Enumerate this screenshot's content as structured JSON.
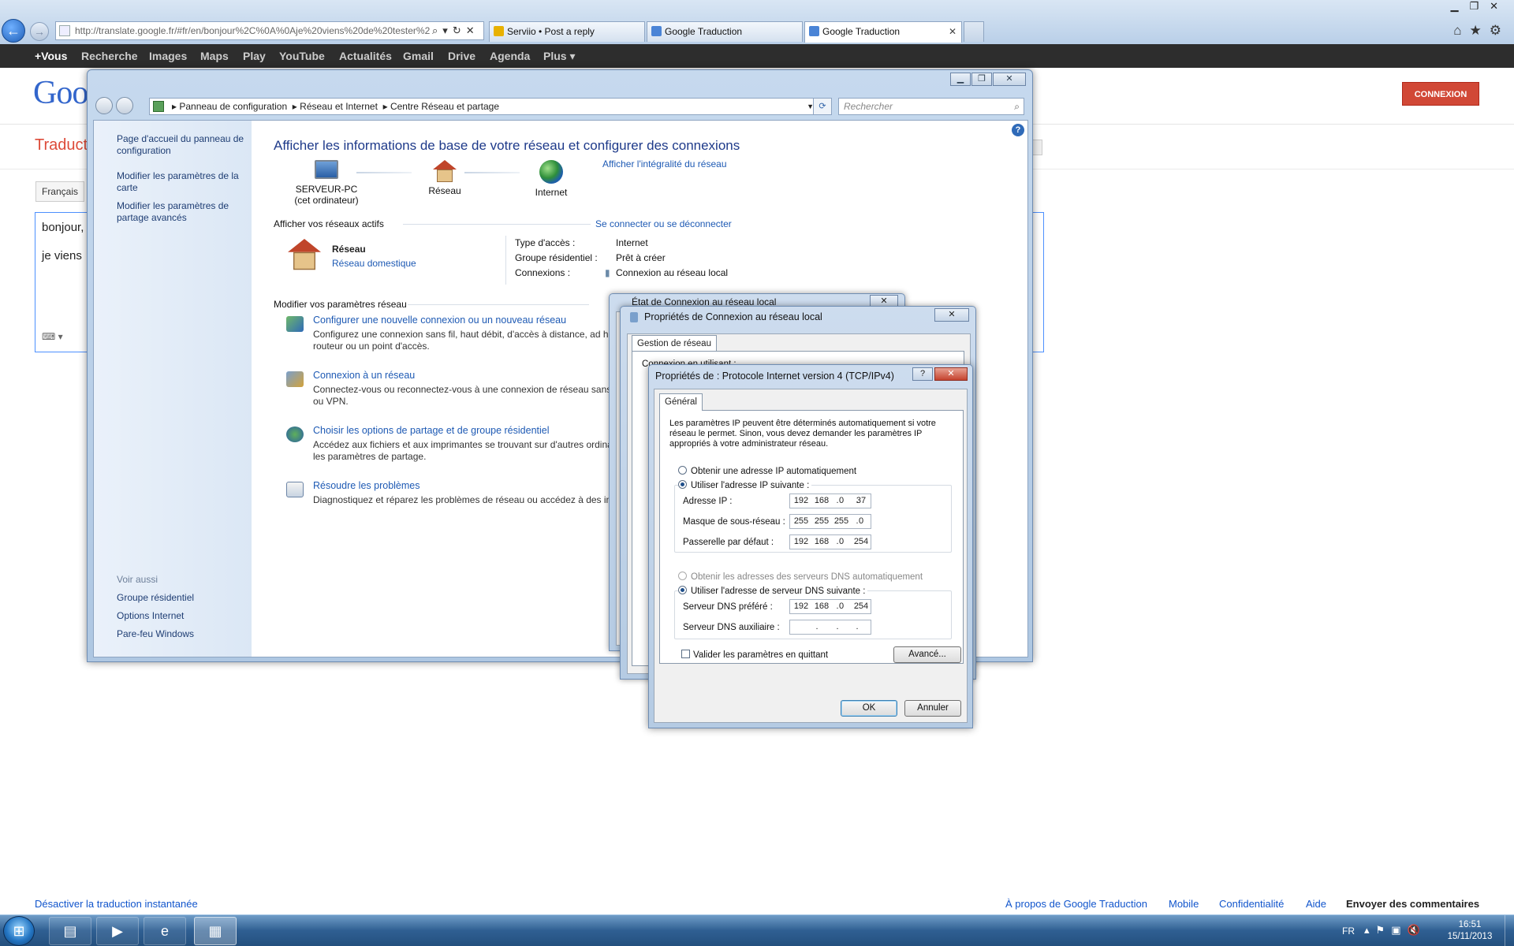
{
  "browser": {
    "address": "http://translate.google.fr/#fr/en/bonjour%2C%0A%0Aje%20viens%20de%20tester%2",
    "tabs": [
      {
        "label": "Serviio • Post a reply",
        "color": "#e8b100"
      },
      {
        "label": "Google Traduction",
        "color": "#4a84d6"
      },
      {
        "label": "Google Traduction",
        "color": "#4a84d6"
      }
    ]
  },
  "gbar": [
    "+Vous",
    "Recherche",
    "Images",
    "Maps",
    "Play",
    "YouTube",
    "Actualités",
    "Gmail",
    "Drive",
    "Agenda",
    "Plus ▾"
  ],
  "google": {
    "logo": "Goo",
    "signin": "CONNEXION",
    "section": "Traduct",
    "source_lang": "Français",
    "input_line1": "bonjour,",
    "input_line2": "je viens",
    "footer": {
      "disable": "Désactiver la traduction instantanée",
      "about": "À propos de Google Traduction",
      "mobile": "Mobile",
      "privacy": "Confidentialité",
      "help": "Aide",
      "feedback": "Envoyer des commentaires"
    }
  },
  "control_panel": {
    "breadcrumb": [
      "Panneau de configuration",
      "Réseau et Internet",
      "Centre Réseau et partage"
    ],
    "search_placeholder": "Rechercher",
    "sidebar": {
      "home": "Page d'accueil du panneau de configuration",
      "adapter": "Modifier les paramètres de la carte",
      "sharing": "Modifier les paramètres de partage avancés",
      "see_also": "Voir aussi",
      "homegroup": "Groupe résidentiel",
      "inet_options": "Options Internet",
      "firewall": "Pare-feu Windows"
    },
    "title": "Afficher les informations de base de votre réseau et configurer des connexions",
    "map": {
      "pc": "SERVEUR-PC",
      "pc_sub": "(cet ordinateur)",
      "network": "Réseau",
      "internet": "Internet",
      "full_map": "Afficher l'intégralité du réseau"
    },
    "active": {
      "heading": "Afficher vos réseaux actifs",
      "connect_link": "Se connecter ou se déconnecter",
      "name": "Réseau",
      "type": "Réseau domestique",
      "access_label": "Type d'accès :",
      "access_value": "Internet",
      "homegroup_label": "Groupe résidentiel :",
      "homegroup_value": "Prêt à créer",
      "connections_label": "Connexions :",
      "connections_value": "Connexion au réseau local"
    },
    "change": {
      "heading": "Modifier vos paramètres réseau",
      "tasks": [
        {
          "title": "Configurer une nouvelle connexion ou un nouveau réseau",
          "desc1": "Configurez une connexion sans fil, haut débit, d'accès à distance, ad ho",
          "desc2": "routeur ou un point d'accès."
        },
        {
          "title": "Connexion à un réseau",
          "desc1": "Connectez-vous ou reconnectez-vous à une connexion de réseau sans f",
          "desc2": "ou VPN."
        },
        {
          "title": "Choisir les options de partage et de groupe résidentiel",
          "desc1": "Accédez aux fichiers et aux imprimantes se trouvant sur d'autres ordinat",
          "desc2": "les paramètres de partage."
        },
        {
          "title": "Résoudre les problèmes",
          "desc1": "Diagnostiquez et réparez les problèmes de réseau ou accédez à des info",
          "desc2": ""
        }
      ]
    }
  },
  "etat_dialog": {
    "title": "État de Connexion au réseau local"
  },
  "prop_dialog": {
    "title": "Propriétés de Connexion au réseau local",
    "tab": "Gestion de réseau",
    "content": "Connexion en utilisant :"
  },
  "ipv4_dialog": {
    "title": "Propriétés de : Protocole Internet version 4 (TCP/IPv4)",
    "tab": "Général",
    "description": "Les paramètres IP peuvent être déterminés automatiquement si votre réseau le permet. Sinon, vous devez demander les paramètres IP appropriés à votre administrateur réseau.",
    "auto_ip": "Obtenir une adresse IP automatiquement",
    "manual_ip": "Utiliser l'adresse IP suivante :",
    "ip_label": "Adresse IP :",
    "ip": [
      "192",
      "168",
      "0",
      "37"
    ],
    "mask_label": "Masque de sous-réseau :",
    "mask": [
      "255",
      "255",
      "255",
      "0"
    ],
    "gw_label": "Passerelle par défaut :",
    "gw": [
      "192",
      "168",
      "0",
      "254"
    ],
    "auto_dns": "Obtenir les adresses des serveurs DNS automatiquement",
    "manual_dns": "Utiliser l'adresse de serveur DNS suivante :",
    "dns1_label": "Serveur DNS préféré :",
    "dns1": [
      "192",
      "168",
      "0",
      "254"
    ],
    "dns2_label": "Serveur DNS auxiliaire :",
    "validate": "Valider les paramètres en quittant",
    "advanced": "Avancé...",
    "ok": "OK",
    "cancel": "Annuler"
  },
  "taskbar": {
    "lang": "FR",
    "time": "16:51",
    "date": "15/11/2013"
  }
}
